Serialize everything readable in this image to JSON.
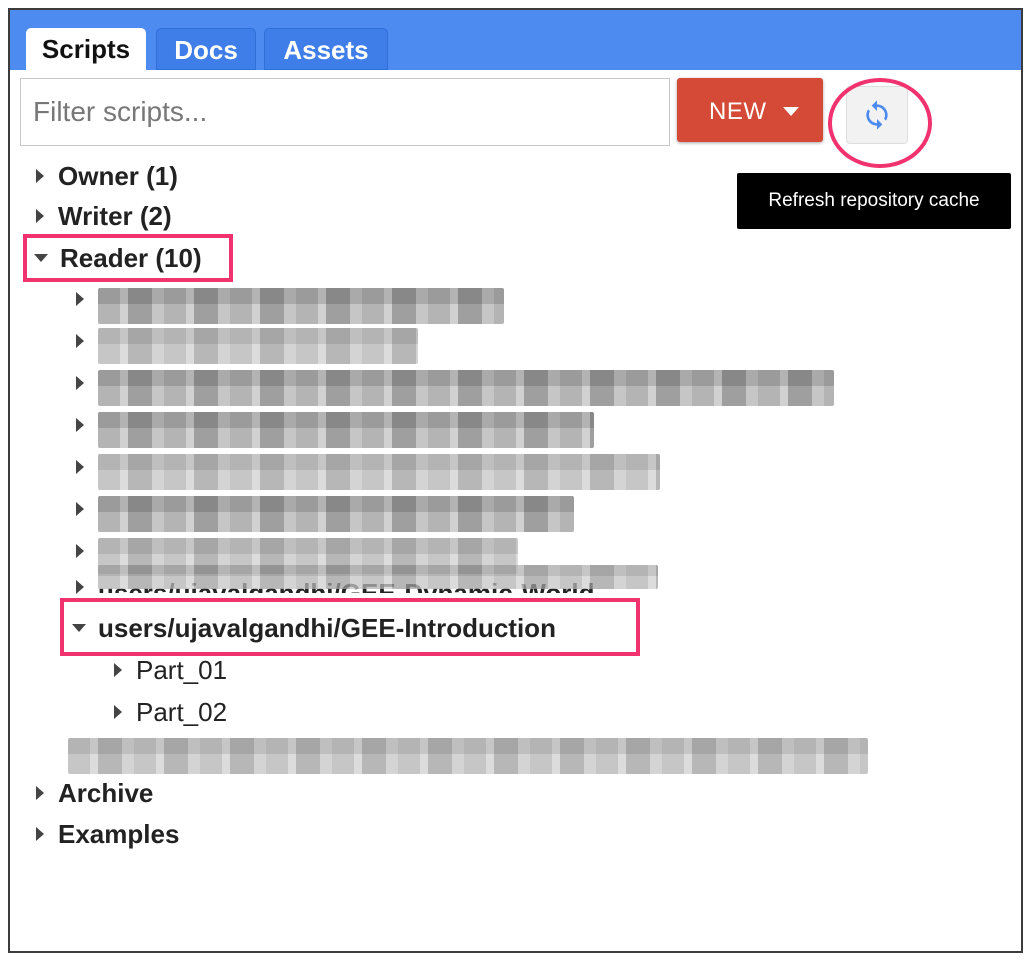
{
  "tabs": [
    {
      "label": "Scripts",
      "active": true
    },
    {
      "label": "Docs",
      "active": false
    },
    {
      "label": "Assets",
      "active": false
    }
  ],
  "filter": {
    "placeholder": "Filter scripts..."
  },
  "new_button": {
    "label": "NEW"
  },
  "refresh_button": {
    "icon": "refresh-icon",
    "tooltip": "Refresh repository cache"
  },
  "tree": {
    "owner": "Owner (1)",
    "writer": "Writer (2)",
    "reader": "Reader (10)",
    "partial_repo": "users/ujavalgandhi/GEE-Dynamic-World",
    "gee_intro": "users/ujavalgandhi/GEE-Introduction",
    "part01": "Part_01",
    "part02": "Part_02",
    "archive": "Archive",
    "examples": "Examples"
  },
  "colors": {
    "tab_bar": "#4d8bf0",
    "new_button": "#d44a36",
    "highlight": "#f0326e",
    "refresh_icon": "#4d8bf0"
  }
}
